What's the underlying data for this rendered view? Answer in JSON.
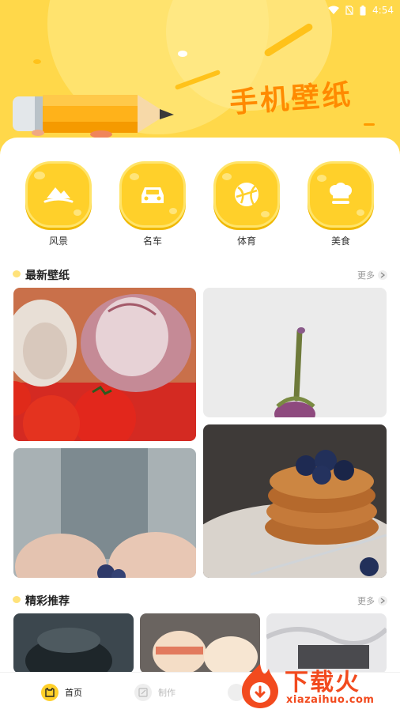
{
  "status": {
    "time": "4:54"
  },
  "header": {
    "title": "手机壁纸"
  },
  "categories": [
    {
      "label": "风景",
      "icon": "mountain-icon"
    },
    {
      "label": "名车",
      "icon": "car-icon"
    },
    {
      "label": "体育",
      "icon": "ball-icon"
    },
    {
      "label": "美食",
      "icon": "chef-hat-icon"
    }
  ],
  "sections": {
    "latest": {
      "title": "最新壁纸",
      "more": "更多"
    },
    "featured": {
      "title": "精彩推荐",
      "more": "更多"
    }
  },
  "latest_tiles": [
    {
      "subject": "garlic-and-tomatoes"
    },
    {
      "subject": "eggplant-on-white"
    },
    {
      "subject": "hands-holding-blueberries"
    },
    {
      "subject": "pancakes-with-blueberries"
    }
  ],
  "featured_tiles": [
    {
      "subject": "chocolate-dessert"
    },
    {
      "subject": "macarons"
    },
    {
      "subject": "marble-texture"
    }
  ],
  "bottom_nav": [
    {
      "label": "首页",
      "active": true
    },
    {
      "label": "制作",
      "active": false
    }
  ],
  "watermark": {
    "text": "下载火",
    "url": "xiazaihuo.com"
  },
  "colors": {
    "brand_yellow": "#ffd84a",
    "accent_orange": "#ff8a00",
    "watermark_red": "#f24a1e"
  }
}
